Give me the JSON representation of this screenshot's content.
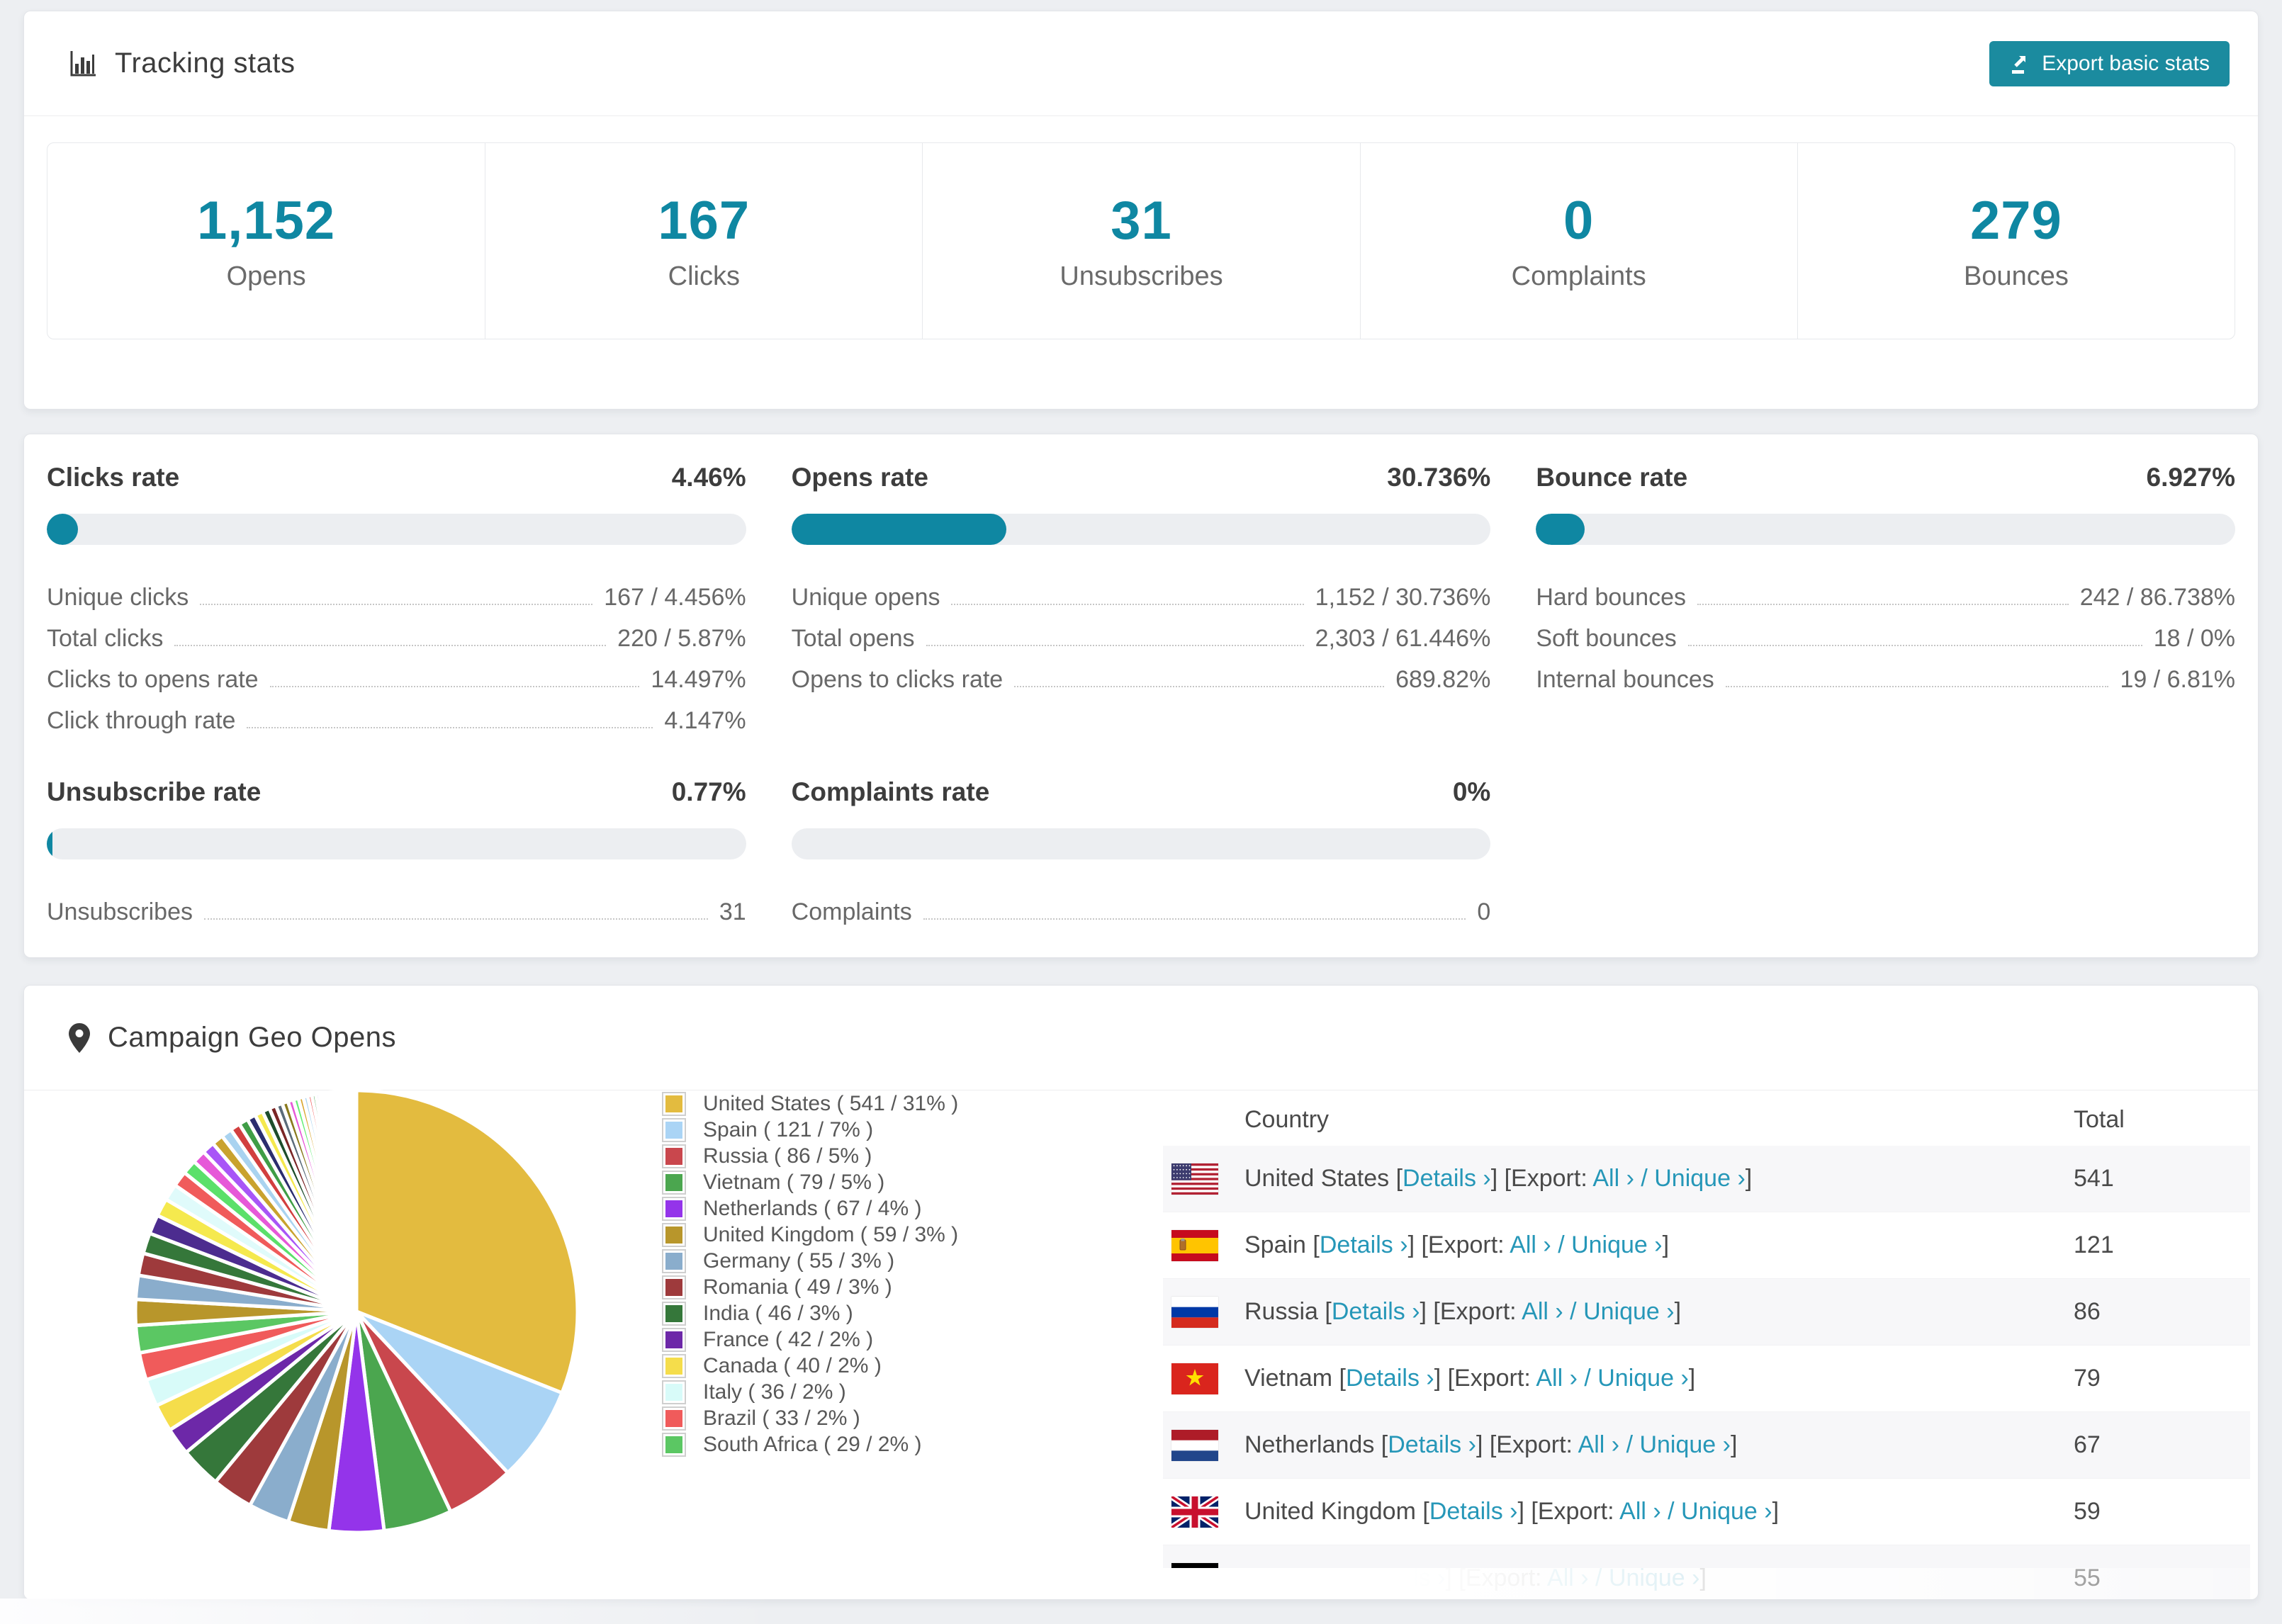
{
  "header": {
    "title": "Tracking stats",
    "export_label": "Export basic stats"
  },
  "summary": [
    {
      "value": "1,152",
      "label": "Opens"
    },
    {
      "value": "167",
      "label": "Clicks"
    },
    {
      "value": "31",
      "label": "Unsubscribes"
    },
    {
      "value": "0",
      "label": "Complaints"
    },
    {
      "value": "279",
      "label": "Bounces"
    }
  ],
  "rates": [
    {
      "title": "Clicks rate",
      "value": "4.46%",
      "pct": 4.46,
      "rows": [
        {
          "label": "Unique clicks",
          "value": "167 / 4.456%"
        },
        {
          "label": "Total clicks",
          "value": "220 / 5.87%"
        },
        {
          "label": "Clicks to opens rate",
          "value": "14.497%"
        },
        {
          "label": "Click through rate",
          "value": "4.147%"
        }
      ]
    },
    {
      "title": "Opens rate",
      "value": "30.736%",
      "pct": 30.736,
      "rows": [
        {
          "label": "Unique opens",
          "value": "1,152 / 30.736%"
        },
        {
          "label": "Total opens",
          "value": "2,303 / 61.446%"
        },
        {
          "label": "Opens to clicks rate",
          "value": "689.82%"
        }
      ]
    },
    {
      "title": "Bounce rate",
      "value": "6.927%",
      "pct": 6.927,
      "rows": [
        {
          "label": "Hard bounces",
          "value": "242 / 86.738%"
        },
        {
          "label": "Soft bounces",
          "value": "18 / 0%"
        },
        {
          "label": "Internal bounces",
          "value": "19 / 6.81%"
        }
      ]
    },
    {
      "title": "Unsubscribe rate",
      "value": "0.77%",
      "pct": 0.77,
      "rows": [
        {
          "label": "Unsubscribes",
          "value": "31"
        }
      ]
    },
    {
      "title": "Complaints rate",
      "value": "0%",
      "pct": 0,
      "rows": [
        {
          "label": "Complaints",
          "value": "0"
        }
      ]
    }
  ],
  "geo": {
    "title": "Campaign Geo Opens",
    "table_headers": {
      "country": "Country",
      "total": "Total"
    },
    "links": {
      "details": "Details ›",
      "all": "All ›",
      "unique": "Unique ›",
      "open_bracket": "[",
      "close_bracket": "]",
      "export_prefix": "[Export:",
      "slash": "/"
    },
    "rows": [
      {
        "country": "United States",
        "flag": "us",
        "total": "541"
      },
      {
        "country": "Spain",
        "flag": "es",
        "total": "121"
      },
      {
        "country": "Russia",
        "flag": "ru",
        "total": "86"
      },
      {
        "country": "Vietnam",
        "flag": "vn",
        "total": "79"
      },
      {
        "country": "Netherlands",
        "flag": "nl",
        "total": "67"
      },
      {
        "country": "United Kingdom",
        "flag": "gb",
        "total": "59"
      },
      {
        "country": "Germany",
        "flag": "de",
        "total": "55",
        "partial": true
      }
    ]
  },
  "chart_data": {
    "type": "pie",
    "title": "Campaign Geo Opens",
    "legend_position": "right",
    "start_angle_deg": -90,
    "direction": "clockwise",
    "series": [
      {
        "label": "United States",
        "value": 541,
        "pct": 31,
        "color": "#e3bb3f"
      },
      {
        "label": "Spain",
        "value": 121,
        "pct": 7,
        "color": "#aad4f5"
      },
      {
        "label": "Russia",
        "value": 86,
        "pct": 5,
        "color": "#c9474d"
      },
      {
        "label": "Vietnam",
        "value": 79,
        "pct": 5,
        "color": "#4ba64f"
      },
      {
        "label": "Netherlands",
        "value": 67,
        "pct": 4,
        "color": "#9434ea"
      },
      {
        "label": "United Kingdom",
        "value": 59,
        "pct": 3,
        "color": "#b8962b"
      },
      {
        "label": "Germany",
        "value": 55,
        "pct": 3,
        "color": "#8aadcc"
      },
      {
        "label": "Romania",
        "value": 49,
        "pct": 3,
        "color": "#9e3a3c"
      },
      {
        "label": "India",
        "value": 46,
        "pct": 3,
        "color": "#35773a"
      },
      {
        "label": "France",
        "value": 42,
        "pct": 2,
        "color": "#6d28a8"
      },
      {
        "label": "Canada",
        "value": 40,
        "pct": 2,
        "color": "#f5dd4b"
      },
      {
        "label": "Italy",
        "value": 36,
        "pct": 2,
        "color": "#d8fbf9"
      },
      {
        "label": "Brazil",
        "value": 33,
        "pct": 2,
        "color": "#f05b5b"
      },
      {
        "label": "South Africa",
        "value": 29,
        "pct": 2,
        "color": "#5bc763"
      }
    ],
    "others_estimated": {
      "total_pct": 26,
      "slice_count": 48,
      "decay": 0.93,
      "palette": [
        "#b8962b",
        "#8aadcc",
        "#9e3a3c",
        "#35773a",
        "#4c2c8f",
        "#f5e94e",
        "#e0fbfb",
        "#f05b5b",
        "#5be06a",
        "#e658d8",
        "#a855f7",
        "#c9a22e",
        "#a9d3f0",
        "#d23f3f",
        "#3f9d46",
        "#2b2d6e",
        "#f5e94e",
        "#1d4d2b",
        "#7a2626",
        "#5a6b7a",
        "#8a7a1e",
        "#e658d8",
        "#66ee77",
        "#d9a62e",
        "#a9d3f0",
        "#f05b5b",
        "#3f9d46",
        "#8b5cf6",
        "#c9a22e",
        "#86c5ea",
        "#d23f3f",
        "#4ba64f",
        "#6d28a8",
        "#e3bb3f",
        "#9434ea",
        "#5bc763",
        "#f05b5b",
        "#d8fbf9",
        "#f5dd4b",
        "#6d28a8",
        "#35773a",
        "#9e3a3c",
        "#8aadcc",
        "#b8962b",
        "#4ba64f",
        "#c9474d",
        "#aad4f5",
        "#9434ea"
      ]
    },
    "legend_label_format": "{label} ( {value} / {pct}% )"
  },
  "colors": {
    "accent_teal": "#0f87a2",
    "button_teal": "#1b8b9f",
    "link_teal": "#2697b8",
    "bar_track": "#eceef1",
    "stripe_row": "#f7f7f9",
    "page_bg": "#edeff2"
  }
}
